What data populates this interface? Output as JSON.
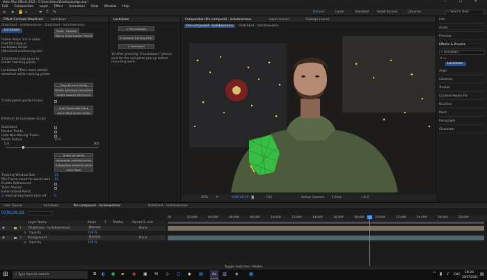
{
  "title": "dobe After Effects 2021 - C:\\Users\\leonc\\Desktop\\badge.aep *",
  "menu": [
    "Edit",
    "Composition",
    "Layer",
    "Effect",
    "Animation",
    "View",
    "Window",
    "Help"
  ],
  "workspaces": [
    "Default",
    "Learn",
    "Standard",
    "Small Screen",
    "Libraries"
  ],
  "search_help": "Search Help",
  "left": {
    "tabs": [
      "Effect Controls Stabilized",
      "Lockdown"
    ],
    "path": "Stabilized - lockdownmov - Stabilized - lockdownmov",
    "badge": "Lockdown",
    "reset": "Reset",
    "register": "Register",
    "mocha": "Mocha Track/Tracker Project",
    "instr": [
      "Follow Steps 1-9 in order.",
      "Find first step in",
      "Lockdown Script",
      "(Window/Lockdown/guide)",
      "",
      "3 Ctrl/Cmd-click layer to",
      "create tracking points",
      "",
      "Lockdown Effect must remain",
      "stretched while tracking points"
    ],
    "btns": [
      "Press to track points",
      "Delete backward keyframes",
      "Delete forward keyframes"
    ],
    "r1": "5 Interpolate partial tracks",
    "auto": "Auto Triangulate Mesh",
    "apply": "Apply Mesh to this frame",
    "return": "8 Return to Lockdown Script",
    "opts": [
      "Stabilized",
      "Render Points",
      "Hide Non-Moving Tracks"
    ],
    "radius_label": "Points Radius",
    "radius_value": "10.0",
    "slider_min": "5.0",
    "slider_max": "360",
    "pbtns": [
      "Select all points",
      "Interpolate selected points",
      "Extrapolate selected points",
      "Clear Mesh"
    ],
    "params": [
      {
        "label": "Tracking Window Size",
        "value": "31"
      },
      {
        "label": "Min Frame count for each track",
        "value": "15"
      },
      {
        "label": "Enable Refinement",
        "value": ""
      },
      {
        "label": "Track Always",
        "value": ""
      },
      {
        "label": "Externalized Points",
        "value": ""
      },
      {
        "label": "Internal keyframe time ref",
        "value": "0"
      }
    ]
  },
  "mid": {
    "tab": "Lockdown",
    "btns": [
      "1 Pre-Compose",
      "2 Outlined Tracking Filter",
      "4 Lockdown!"
    ],
    "note": "10 After pressing '4 Lockdown!' please wait for the complete pop-up before mounting work."
  },
  "viewer": {
    "tabs": [
      "Composition Pre-compositi - lockdownmov",
      "Layer (none)",
      "Footage (none)"
    ],
    "crumbs": [
      "Pre-composed - lockdownmov",
      "Stabilized - lockdownmov"
    ],
    "zoom": "25%",
    "time": "0;09;29;19",
    "res": "Full",
    "camera": "Active Camera",
    "view": "1 View",
    "exposure": "+0.0"
  },
  "right": {
    "items": [
      "Info",
      "Audio",
      "Preview",
      "Effects & Presets",
      "Align",
      "Libraries",
      "Tracker",
      "Content-Aware Fill",
      "Brushes",
      "Paint",
      "Paragraph",
      "Character"
    ],
    "search": "lockdown",
    "tree_item": "Lockdown"
  },
  "timeline": {
    "tabs": [
      "nder Queue",
      "lockdown",
      "Pre-composed - lockdownmov",
      "Stabilized - lockdownmov"
    ],
    "time": "0;09;29;19",
    "cols": [
      "Layer Name",
      "Mode",
      "T",
      "TrkMat",
      "Parent & Link"
    ],
    "layers": [
      {
        "num": "1",
        "name": "[Stabilized - lockdownmov]",
        "mode": "Normal",
        "parent": "None"
      },
      {
        "num": "",
        "name": "Opacity",
        "mode": "",
        "parent": ""
      },
      {
        "num": "2",
        "name": "Background",
        "mode": "Normal",
        "parent": "None"
      },
      {
        "num": "",
        "name": "Opacity",
        "mode": "",
        "parent": ""
      }
    ],
    "opacity1": "100 %",
    "opacity2": "100 %",
    "ruler": [
      "0f",
      "02;00f",
      "04;00f",
      "06;00f",
      "08;00f",
      "10;00f",
      "12;00f",
      "14;00f",
      "16;00f",
      "18;00f",
      "20;00f",
      "22;00f",
      "24;00f",
      "26;00f",
      "28;00f"
    ],
    "toggle": "Toggle Switches / Modes"
  },
  "taskbar": {
    "search": "Type here to search",
    "lang": "ENG",
    "time": "18:20",
    "date": "30/07/2021"
  }
}
